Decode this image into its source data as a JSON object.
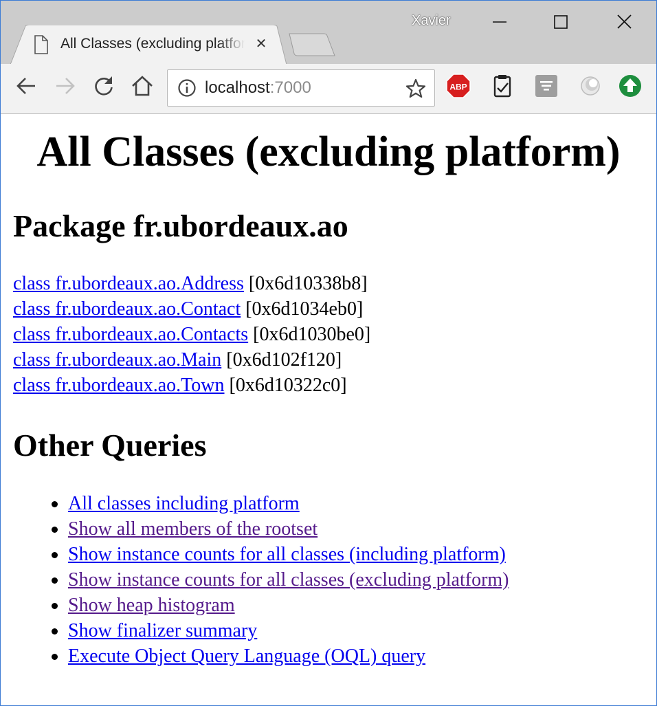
{
  "window": {
    "profile_name": "Xavier",
    "controls": [
      "minimize-icon",
      "maximize-icon",
      "close-icon"
    ]
  },
  "tab": {
    "title": "All Classes (excluding platform)",
    "close_glyph": "✕",
    "icon": "document-icon"
  },
  "toolbar": {
    "back_icon": "arrow-left-icon",
    "forward_icon": "arrow-right-icon",
    "reload_icon": "reload-icon",
    "home_icon": "home-icon",
    "url_host": "localhost",
    "url_port": ":7000",
    "extensions": [
      {
        "name": "adblock-plus-icon",
        "label": "ABP",
        "color": "#d71f1f"
      },
      {
        "name": "clipboard-icon"
      },
      {
        "name": "feed-icon",
        "color": "#9e9e9e"
      },
      {
        "name": "circle-extension-icon"
      },
      {
        "name": "upload-icon",
        "color": "#1e8e3e"
      }
    ]
  },
  "page": {
    "title": "All Classes (excluding platform)",
    "package_heading": "Package fr.ubordeaux.ao",
    "classes": [
      {
        "label": "class fr.ubordeaux.ao.Address",
        "addr": "[0x6d10338b8]"
      },
      {
        "label": "class fr.ubordeaux.ao.Contact",
        "addr": "[0x6d1034eb0]"
      },
      {
        "label": "class fr.ubordeaux.ao.Contacts",
        "addr": "[0x6d1030be0]"
      },
      {
        "label": "class fr.ubordeaux.ao.Main",
        "addr": "[0x6d102f120]"
      },
      {
        "label": "class fr.ubordeaux.ao.Town",
        "addr": "[0x6d10322c0]"
      }
    ],
    "other_heading": "Other Queries",
    "queries": [
      {
        "label": "All classes including platform",
        "visited": false
      },
      {
        "label": "Show all members of the rootset",
        "visited": true
      },
      {
        "label": "Show instance counts for all classes (including platform)",
        "visited": false
      },
      {
        "label": "Show instance counts for all classes (excluding platform)",
        "visited": true
      },
      {
        "label": "Show heap histogram",
        "visited": true
      },
      {
        "label": "Show finalizer summary",
        "visited": false
      },
      {
        "label": "Execute Object Query Language (OQL) query",
        "visited": false
      }
    ]
  },
  "colors": {
    "link": "#0000ee",
    "visited_link": "#551a8b",
    "frame": "#cccccc",
    "toolbar": "#f2f2f2"
  }
}
